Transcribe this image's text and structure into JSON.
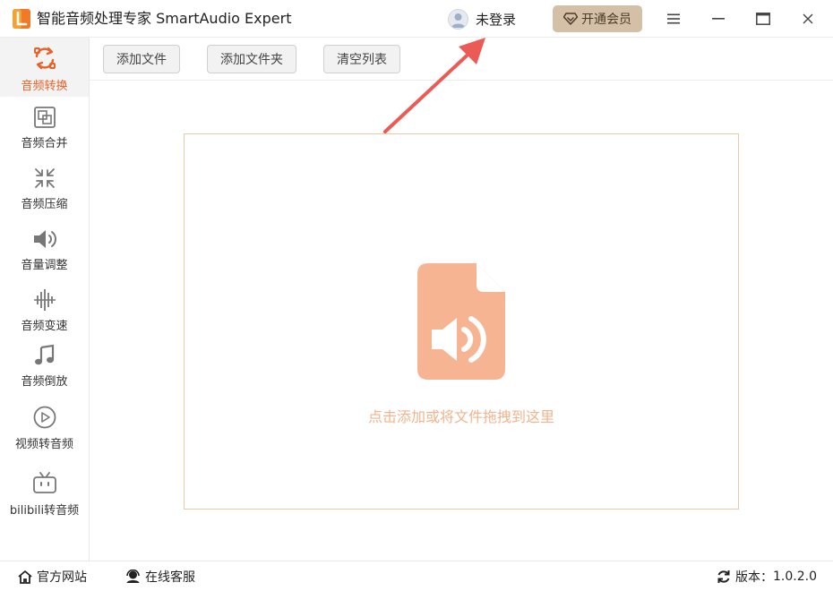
{
  "app": {
    "title": "智能音频处理专家 SmartAudio Expert",
    "user_label": "未登录",
    "vip_label": "开通会员"
  },
  "sidebar": {
    "items": [
      {
        "label": "音频转换",
        "icon": "refresh-convert-icon",
        "active": true
      },
      {
        "label": "音频合并",
        "icon": "merge-icon"
      },
      {
        "label": "音频压缩",
        "icon": "compress-icon"
      },
      {
        "label": "音量调整",
        "icon": "volume-icon"
      },
      {
        "label": "音频变速",
        "icon": "waveform-icon"
      },
      {
        "label": "音频倒放",
        "icon": "music-note-icon"
      },
      {
        "label": "视频转音频",
        "icon": "play-icon"
      },
      {
        "label": "bilibili转音频",
        "icon": "tv-icon"
      }
    ]
  },
  "toolbar": {
    "add_file": "添加文件",
    "add_folder": "添加文件夹",
    "clear_list": "清空列表"
  },
  "dropzone": {
    "hint": "点击添加或将文件拖拽到这里",
    "icon": "audio-file-icon"
  },
  "footer": {
    "website": "官方网站",
    "support": "在线客服",
    "version_label": "版本：",
    "version": "1.0.2.0"
  },
  "colors": {
    "accent": "#e8632b",
    "vip_bg": "#d4c0a6",
    "file_icon": "#f6b493",
    "hint_text": "#f0b48e",
    "dropzone_border": "#e8c9aa",
    "arrow": "#ec5a55"
  }
}
